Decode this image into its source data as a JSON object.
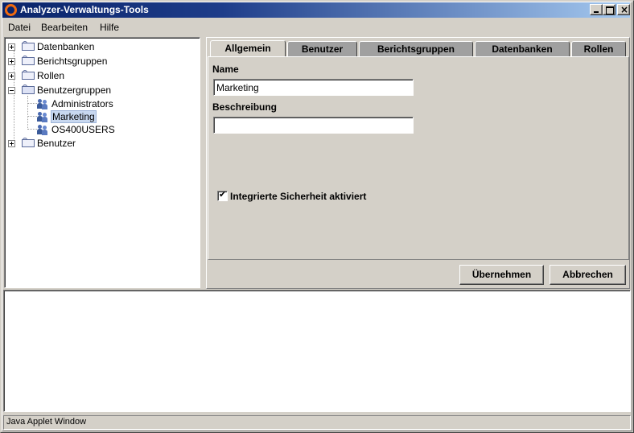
{
  "window": {
    "title": "Analyzer-Verwaltungs-Tools",
    "icon": "orange-ring-icon"
  },
  "menu": {
    "items": [
      {
        "label": "Datei"
      },
      {
        "label": "Bearbeiten"
      },
      {
        "label": "Hilfe"
      }
    ]
  },
  "tree": {
    "nodes": [
      {
        "label": "Datenbanken",
        "expanded": false
      },
      {
        "label": "Berichtsgruppen",
        "expanded": false
      },
      {
        "label": "Rollen",
        "expanded": false
      },
      {
        "label": "Benutzergruppen",
        "expanded": true,
        "children": [
          {
            "label": "Administrators",
            "selected": false
          },
          {
            "label": "Marketing",
            "selected": true
          },
          {
            "label": "OS400USERS",
            "selected": false
          }
        ]
      },
      {
        "label": "Benutzer",
        "expanded": false
      }
    ]
  },
  "tabs": [
    {
      "label": "Allgemein",
      "active": true
    },
    {
      "label": "Benutzer",
      "active": false
    },
    {
      "label": "Berichtsgruppen",
      "active": false
    },
    {
      "label": "Datenbanken",
      "active": false
    },
    {
      "label": "Rollen",
      "active": false
    }
  ],
  "form": {
    "name_label": "Name",
    "name_value": "Marketing",
    "description_label": "Beschreibung",
    "description_value": "",
    "integrated_security_label": "Integrierte Sicherheit aktiviert",
    "integrated_security_checked": true
  },
  "buttons": {
    "apply": "Übernehmen",
    "cancel": "Abbrechen"
  },
  "statusbar": {
    "text": "Java Applet Window"
  },
  "colors": {
    "titlebar_start": "#0a246a",
    "titlebar_end": "#a6caf0",
    "face": "#d4d0c8",
    "inactive_tab": "#a0a0a0",
    "selection": "#c8d8f0"
  }
}
